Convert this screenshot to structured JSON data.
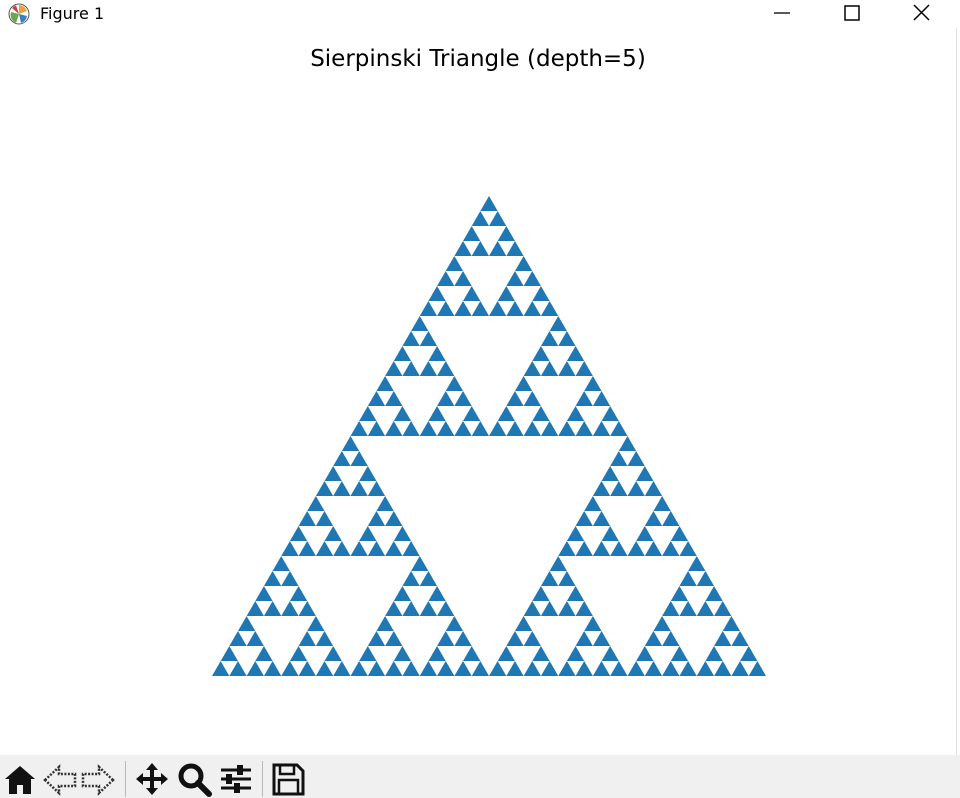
{
  "window": {
    "title": "Figure 1",
    "app_icon": "matplotlib-logo-icon",
    "controls": [
      "minimize-icon",
      "maximize-icon",
      "close-icon"
    ]
  },
  "figure": {
    "title": "Sierpinski Triangle (depth=5)"
  },
  "chart_data": {
    "type": "sierpinski-triangle",
    "title": "Sierpinski Triangle (depth=5)",
    "depth": 5,
    "fill_color": "#1f77b4",
    "background": "#ffffff",
    "axes_visible": false
  },
  "toolbar": {
    "items": [
      "home-icon",
      "back-arrow-icon",
      "forward-arrow-icon",
      "pan-move-icon",
      "zoom-magnifier-icon",
      "configure-subplots-icon",
      "save-floppy-icon"
    ]
  }
}
